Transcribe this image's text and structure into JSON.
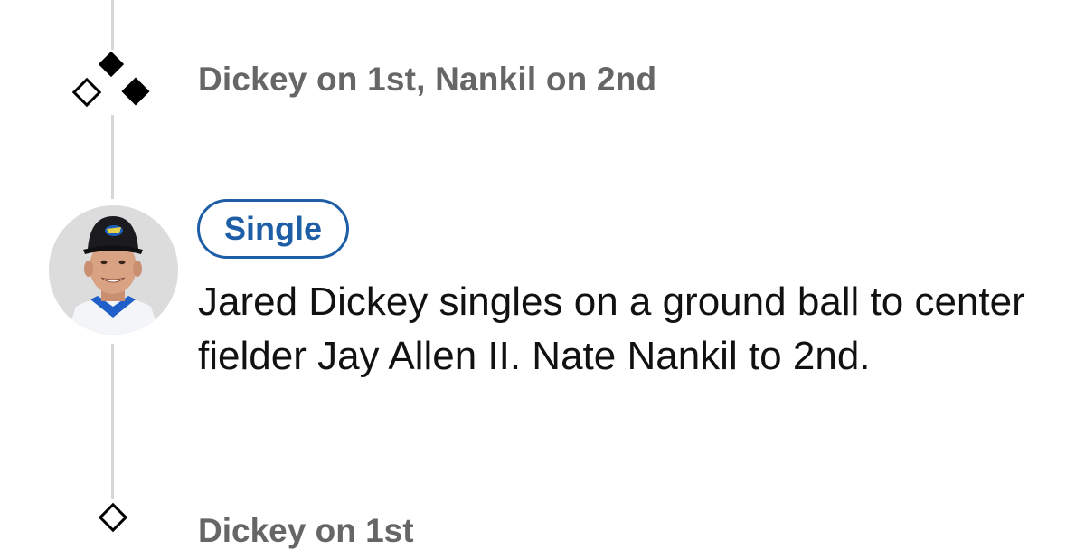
{
  "timeline": {
    "runners_event": {
      "icon": "bases-diamond-icon",
      "text": "Dickey on 1st, Nankil on 2nd",
      "bases": {
        "first": "occupied",
        "second": "occupied",
        "third": "empty"
      }
    },
    "play_event": {
      "badge_label": "Single",
      "description": "Jared Dickey singles on a ground ball to center fielder Jay Allen II. Nate Nankil to 2nd.",
      "player_avatar": "player-headshot",
      "accent_color": "#1e5ea6"
    },
    "next_event": {
      "icon": "bases-diamond-icon",
      "text": "Dickey on 1st"
    }
  }
}
